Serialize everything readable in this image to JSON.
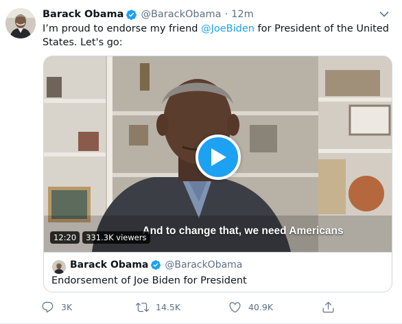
{
  "tweet": {
    "author_name": "Barack Obama",
    "handle": "@BarackObama",
    "separator": "·",
    "time": "12m",
    "text_before": "I’m proud to endorse my friend ",
    "mention": "@JoeBiden",
    "text_after": " for President of the United States. Let's go:"
  },
  "media": {
    "caption": "And to change that, we need Americans",
    "duration": "12:20",
    "viewers": "331.3K viewers"
  },
  "quoted": {
    "author_name": "Barack Obama",
    "handle": "@BarackObama",
    "title": "Endorsement of Joe Biden for President"
  },
  "actions": {
    "replies": "3K",
    "retweets": "14.5K",
    "likes": "40.9K"
  },
  "icons": {
    "verified": "verified-badge-icon",
    "caret": "chevron-down-icon",
    "play": "play-icon",
    "reply": "reply-icon",
    "retweet": "retweet-icon",
    "like": "heart-icon",
    "share": "share-icon"
  },
  "colors": {
    "accent": "#1da1f2",
    "secondary_text": "#5b7083",
    "primary_text": "#0f1419",
    "border": "#cfd9de"
  }
}
